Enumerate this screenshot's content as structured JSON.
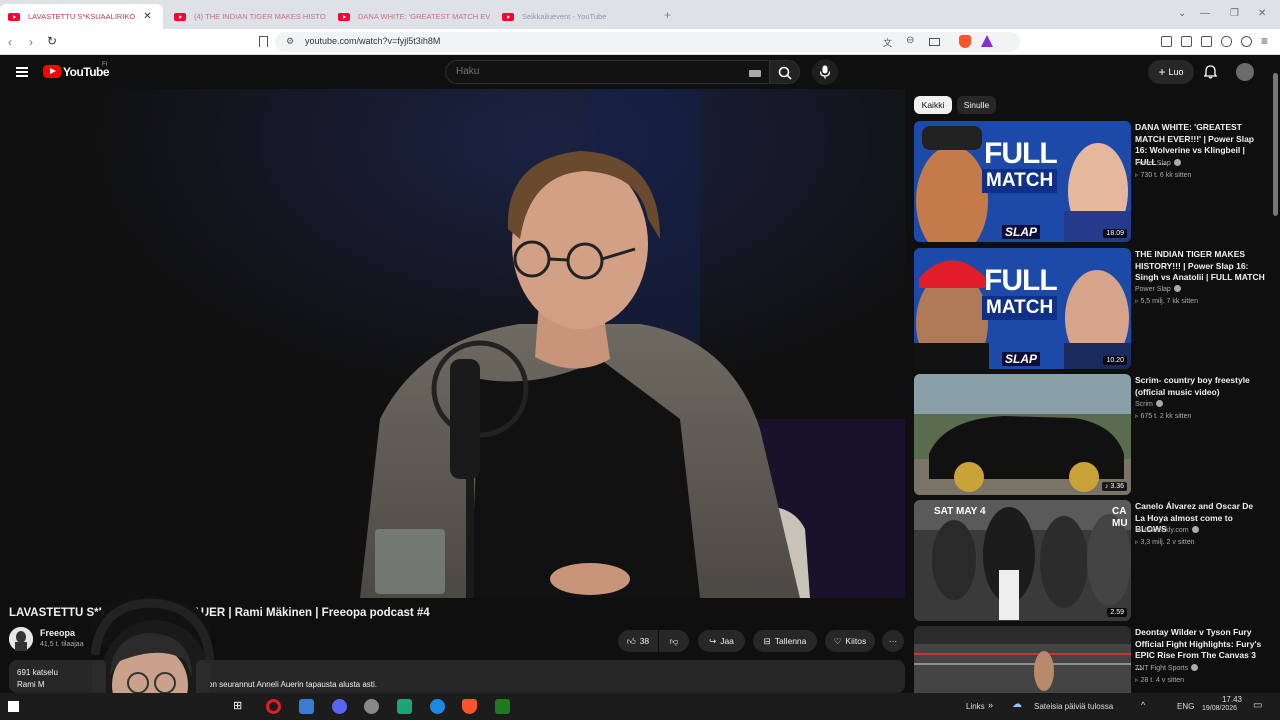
{
  "browser": {
    "tabs": [
      {
        "title": "LAVASTETTU S*KSUAALIRIKO",
        "active": true
      },
      {
        "title": "(4) THE INDIAN TIGER MAKES HISTO",
        "active": false
      },
      {
        "title": "DANA WHITE: 'GREATEST MATCH EV",
        "active": false
      },
      {
        "title": "Seikkailuevent - YouTube",
        "active": false
      }
    ],
    "new_tab": "+",
    "url": "youtube.com/watch?v=fyjl5t3ih8M",
    "win_controls": {
      "minimize": "—",
      "restore": "❐",
      "close": "✕"
    }
  },
  "masthead": {
    "wordmark": "YouTube",
    "region": "FI",
    "search_placeholder": "Haku",
    "create_label": "Luo"
  },
  "chips": [
    {
      "label": "Kaikki",
      "selected": true
    },
    {
      "label": "Sinulle",
      "selected": false
    }
  ],
  "recommendations": [
    {
      "title": "DANA WHITE: 'GREATEST MATCH EVER!!!' | Power Slap 16: Wolverine vs Klingbeil | FULL ...",
      "channel": "Power Slap",
      "meta": "730 t.   6 kk sitten",
      "duration": "18.09",
      "thumb_big": "FULL",
      "thumb_sub": "MATCH",
      "thumb_badge": "SLAP"
    },
    {
      "title": "THE INDIAN TIGER MAKES HISTORY!!! | Power Slap 16: Singh vs Anatolii | FULL MATCH",
      "channel": "Power Slap",
      "meta": "5,5 milj.   7 kk sitten",
      "duration": "10.20",
      "thumb_big": "FULL",
      "thumb_sub": "MATCH",
      "thumb_badge": "SLAP"
    },
    {
      "title": "Scrim- country boy freestyle (official music video)",
      "channel": "Scrim",
      "meta": "675 t.   2 kk sitten",
      "duration": "3.36"
    },
    {
      "title": "Canelo Álvarez and Oscar De La Hoya almost come to BLOWS",
      "channel": "MMAWeekly.com",
      "meta": "3,3 milj.   2 v sitten",
      "duration": "2.59",
      "thumb_big": "SAT MAY 4",
      "thumb_sub": "CA MU"
    },
    {
      "title": "Deontay Wilder v Tyson Fury Official Fight Highlights: Fury's EPIC Rise From The Canvas 3 ...",
      "channel": "TNT Fight Sports",
      "meta": "28 t.   4 v sitten"
    }
  ],
  "video": {
    "title": "LAVASTETTU S*K",
    "title_rest": "ANNELI AUER | Rami Mäkinen | Freeopa podcast #4",
    "channel": "Freeopa",
    "subscribers": "41,5 t. tilaajaa",
    "likes": "38",
    "share_label": "Jaa",
    "save_label": "Tallenna",
    "thanks_label": "Kiitos",
    "more_label": "···",
    "desc_views": "691 katselu",
    "desc_line2": "Rami M",
    "desc_text": "on seurannut Anneli Auerin tapausta alusta asti."
  },
  "taskbar": {
    "links": "Links",
    "weather": "Sateisia päiviä tulossa",
    "lang": "ENG",
    "time": "17.43",
    "date": "19/08/2026"
  },
  "colors": {
    "yt_red": "#ff0000",
    "bg": "#0f0f0f",
    "chip_selected": "#f1f1f1",
    "chip": "#272727"
  }
}
